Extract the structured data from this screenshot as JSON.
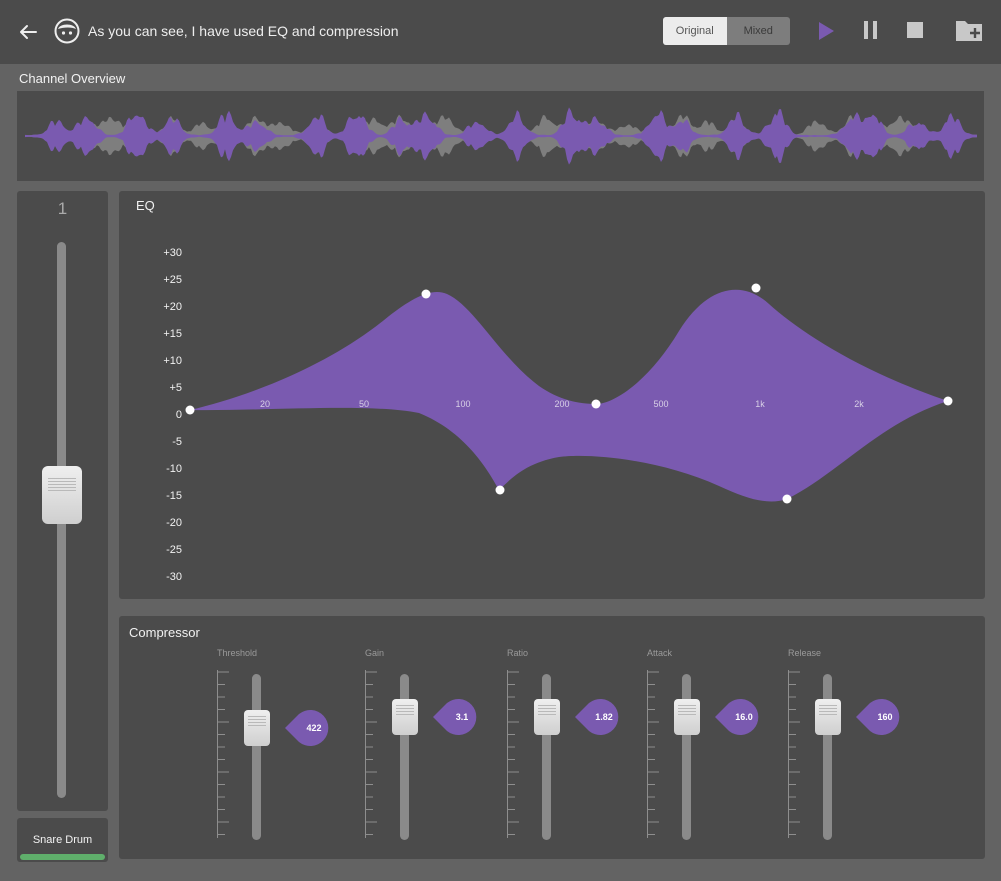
{
  "header": {
    "title": "As you can see, I have used EQ and compression",
    "toggle": {
      "original_label": "Original",
      "mixed_label": "Mixed",
      "selected": "Original"
    },
    "icons": [
      "back-arrow-icon",
      "avatar-icon",
      "play-icon",
      "pause-icon",
      "stop-icon",
      "add-folder-icon"
    ],
    "accent_color": "#7a5ab0"
  },
  "overview": {
    "label": "Channel Overview"
  },
  "channel": {
    "number": "1",
    "name": "Snare Drum",
    "status_color": "#5faf6b",
    "fader_level": 0.55
  },
  "eq": {
    "label": "EQ",
    "db_labels": [
      "+30",
      "+25",
      "+20",
      "+15",
      "+10",
      "+5",
      "0",
      "-5",
      "-10",
      "-15",
      "-20",
      "-25",
      "-30"
    ],
    "freq_labels": [
      "20",
      "50",
      "100",
      "200",
      "500",
      "1k",
      "2k"
    ]
  },
  "compressor": {
    "label": "Compressor",
    "controls": [
      {
        "label": "Threshold",
        "value": "422",
        "level": 0.72
      },
      {
        "label": "Gain",
        "value": "3.1",
        "level": 0.81
      },
      {
        "label": "Ratio",
        "value": "1.82",
        "level": 0.81
      },
      {
        "label": "Attack",
        "value": "16.0",
        "level": 0.81
      },
      {
        "label": "Release",
        "value": "160",
        "level": 0.81
      }
    ]
  }
}
